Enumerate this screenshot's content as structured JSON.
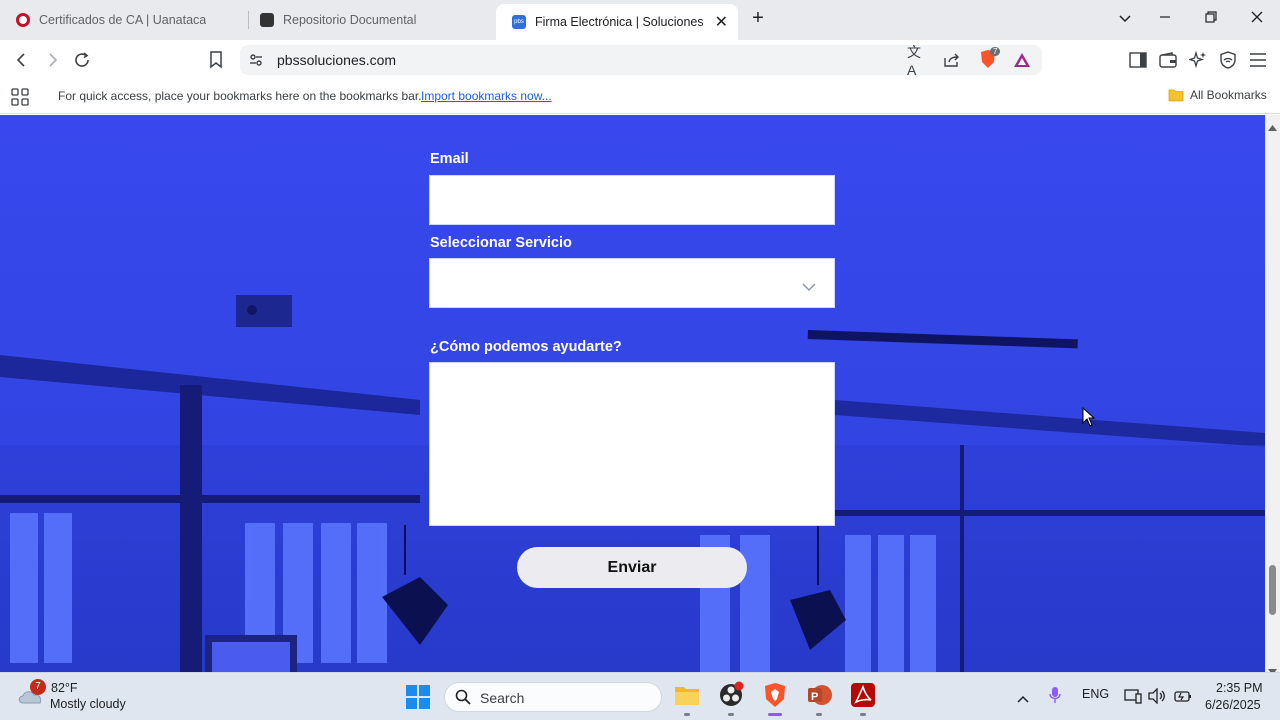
{
  "browser": {
    "tabs": [
      {
        "title": "Certificados de CA | Uanataca",
        "favicon_color": "#c8102e"
      },
      {
        "title": "Repositorio Documental",
        "favicon_color": "#333333"
      },
      {
        "title": "Firma Electrónica | Soluciones PB",
        "favicon_label": "pbs",
        "favicon_color": "#2f6fd8",
        "active": true
      }
    ],
    "url": "pbssoluciones.com",
    "bookmarks_prompt": "For quick access, place your bookmarks here on the bookmarks bar.",
    "import_link": "Import bookmarks now...",
    "all_bookmarks": "All Bookmarks",
    "shield_badge": "7"
  },
  "form": {
    "email_label": "Email",
    "email_value": "",
    "service_label": "Seleccionar Servicio",
    "service_value": "",
    "message_label": "¿Cómo podemos ayudarte?",
    "message_value": "",
    "submit_label": "Enviar"
  },
  "taskbar": {
    "weather_temp": "82°F",
    "weather_desc": "Mostly cloudy",
    "weather_badge": "7",
    "search_placeholder": "Search",
    "language": "ENG",
    "time": "2:35 PM",
    "date": "6/26/2025"
  },
  "colors": {
    "page_blue": "#3446e6",
    "brave_orange": "#fb542b",
    "active_tab_indicator": "#8b5cf6"
  }
}
